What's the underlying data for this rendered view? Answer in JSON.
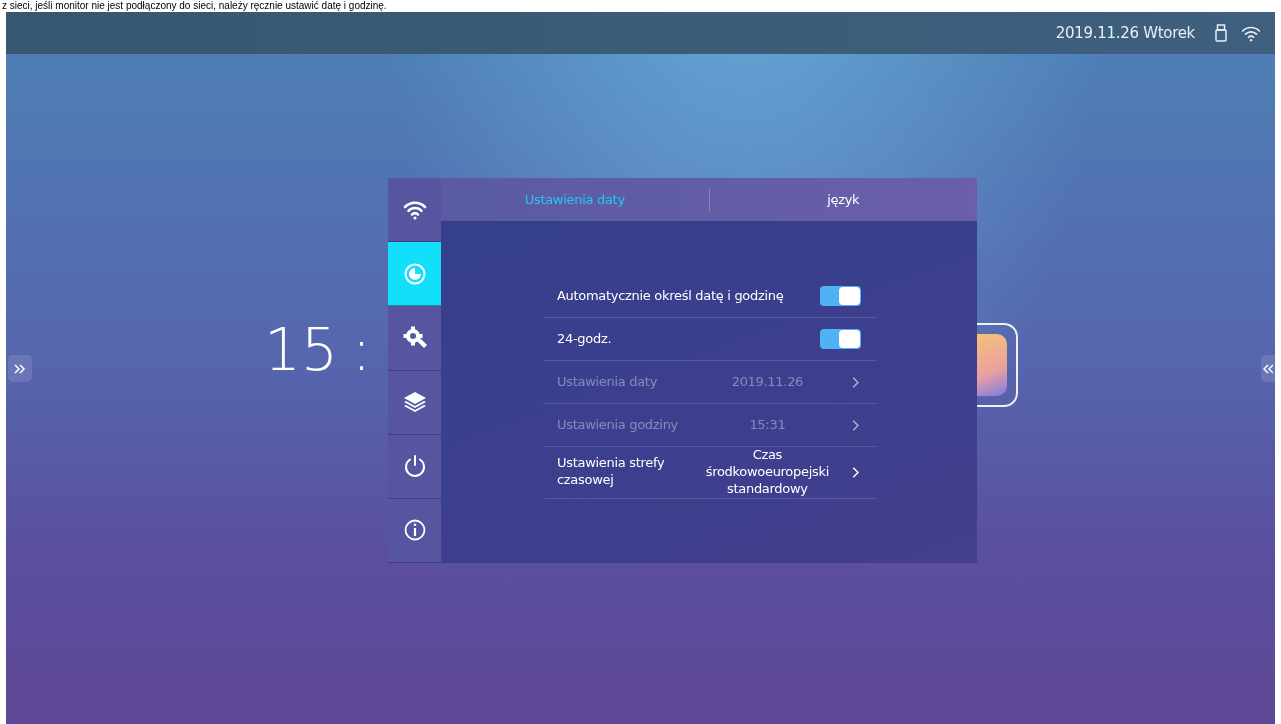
{
  "caption": "z sieci, jeśli monitor nie jest podłączony do sieci, należy ręcznie ustawić datę i godzinę.",
  "status_bar": {
    "date": "2019.11.26 Wtorek"
  },
  "clock": {
    "hours": "15",
    "separator": ":"
  },
  "sidebar": {
    "items": [
      {
        "kind": "wifi",
        "selected": false
      },
      {
        "kind": "clock",
        "selected": true
      },
      {
        "kind": "gear",
        "selected": false
      },
      {
        "kind": "layers",
        "selected": false
      },
      {
        "kind": "power",
        "selected": false
      },
      {
        "kind": "info",
        "selected": false
      }
    ]
  },
  "tabs": [
    {
      "label": "Ustawienia daty",
      "selected": true
    },
    {
      "label": "język",
      "selected": false
    }
  ],
  "rows": [
    {
      "kind": "toggle",
      "label": "Automatycznie określ datę i godzinę",
      "on": true
    },
    {
      "kind": "toggle",
      "label": "24-godz.",
      "on": true
    },
    {
      "kind": "link",
      "label": "Ustawienia daty",
      "value": "2019.11.26",
      "disabled": true
    },
    {
      "kind": "link",
      "label": "Ustawienia godziny",
      "value": "15:31",
      "disabled": true
    },
    {
      "kind": "link",
      "label": "Ustawienia strefy czasowej",
      "value": "Czas środkowoeuropejski standardowy",
      "disabled": false
    }
  ]
}
